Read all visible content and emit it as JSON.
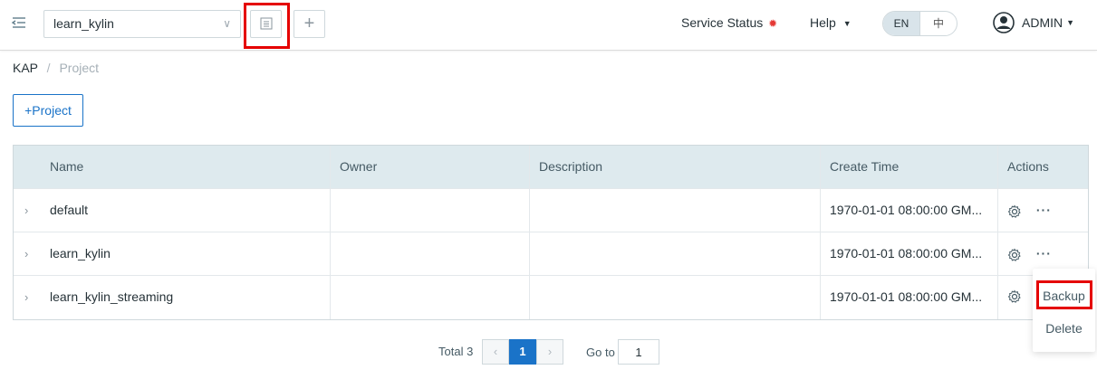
{
  "header": {
    "project_selected": "learn_kylin",
    "service_status_label": "Service Status",
    "help_label": "Help",
    "lang": {
      "en": "EN",
      "zh": "中",
      "active": "EN"
    },
    "user_label": "ADMIN"
  },
  "breadcrumb": {
    "root": "KAP",
    "separator": "/",
    "current": "Project"
  },
  "actions": {
    "add_project_label": "+Project"
  },
  "table": {
    "columns": [
      "Name",
      "Owner",
      "Description",
      "Create Time",
      "Actions"
    ],
    "rows": [
      {
        "name": "default",
        "owner": "",
        "description": "",
        "create_time": "1970-01-01 08:00:00 GM..."
      },
      {
        "name": "learn_kylin",
        "owner": "",
        "description": "",
        "create_time": "1970-01-01 08:00:00 GM..."
      },
      {
        "name": "learn_kylin_streaming",
        "owner": "",
        "description": "",
        "create_time": "1970-01-01 08:00:00 GM..."
      }
    ]
  },
  "dropdown": {
    "items": [
      "Backup",
      "Delete"
    ]
  },
  "pagination": {
    "total_label": "Total 3",
    "current_page": "1",
    "goto_label": "Go to",
    "goto_value": "1"
  },
  "colors": {
    "accent": "#1a73c8",
    "highlight": "#e50000",
    "status_dot": "#e53935",
    "table_header": "#deeaee"
  }
}
